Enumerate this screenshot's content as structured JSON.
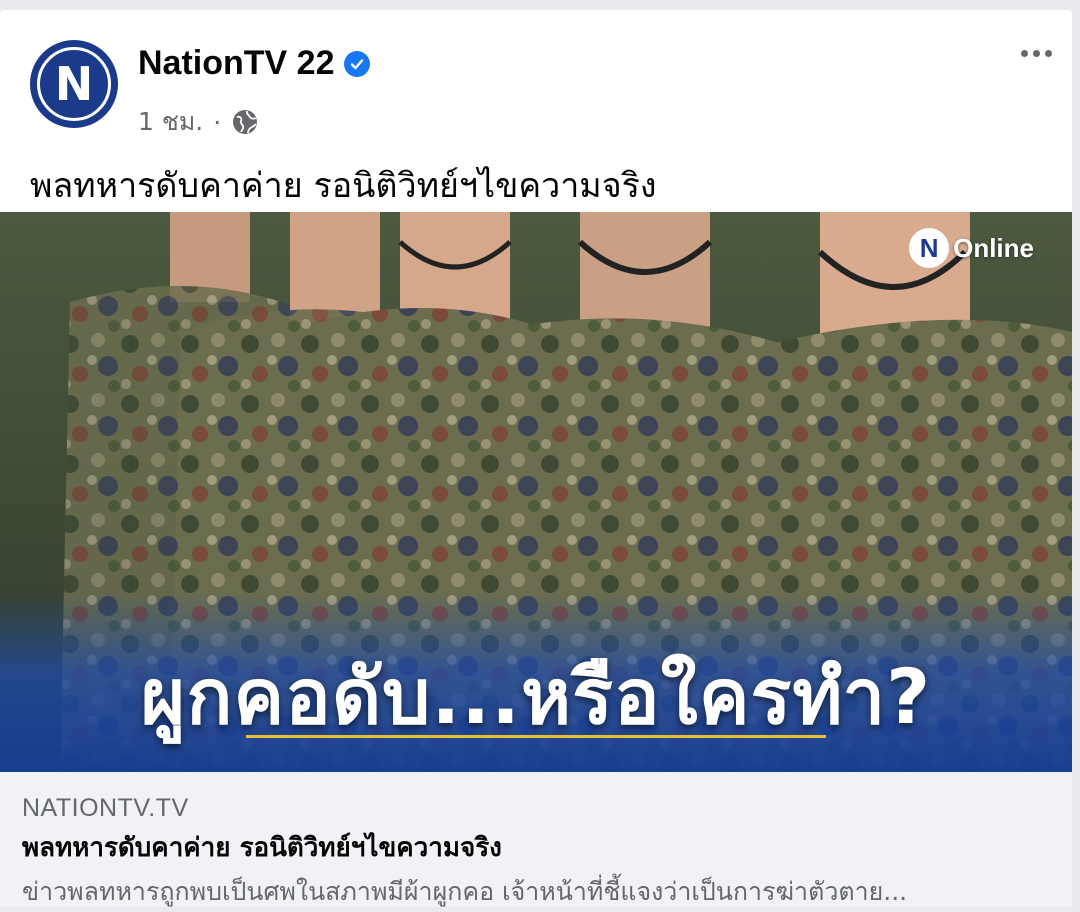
{
  "post": {
    "page_name": "NationTV 22",
    "avatar_letter": "N",
    "time": "1 ชม.",
    "separator": "·",
    "caption": "พลทหารดับคาค่าย รอนิติวิทย์ฯไขความจริง"
  },
  "image": {
    "headline": "ผูกคอดับ...หรือใครทำ?",
    "badge_letter": "N",
    "badge_text": "Online"
  },
  "link_preview": {
    "domain": "NATIONTV.TV",
    "title": "พลทหารดับคาค่าย รอนิติวิทย์ฯไขความจริง",
    "description": "ข่าวพลทหารถูกพบเป็นศพในสภาพมีผ้าผูกคอ เจ้าหน้าที่ชี้แจงว่าเป็นการฆ่าตัวตาย..."
  },
  "colors": {
    "brand_blue": "#1b3a8c",
    "verified_blue": "#1877f2",
    "accent_yellow": "#e6c12f"
  },
  "icons": [
    "verified-badge-icon",
    "globe-icon",
    "more-options-icon"
  ]
}
